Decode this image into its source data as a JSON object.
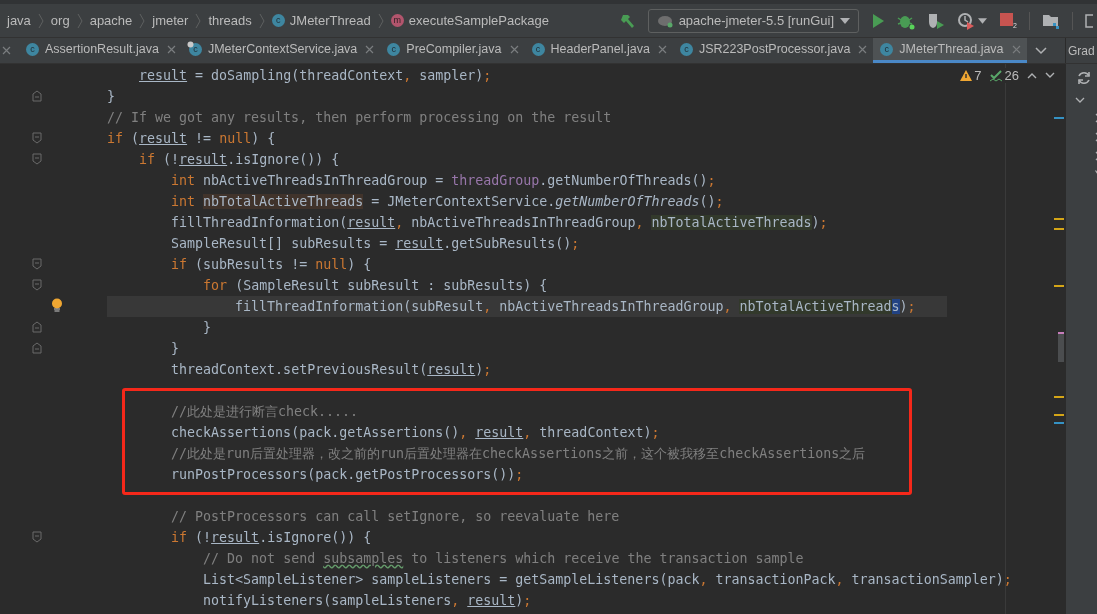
{
  "breadcrumbs": [
    {
      "label": "java"
    },
    {
      "label": "org"
    },
    {
      "label": "apache"
    },
    {
      "label": "jmeter"
    },
    {
      "label": "threads"
    },
    {
      "label": "JMeterThread",
      "kind": "class",
      "badge": "c"
    },
    {
      "label": "executeSamplePackage",
      "kind": "method",
      "badge": "m"
    }
  ],
  "run_config": {
    "label": "apache-jmeter-5.5 [runGui]"
  },
  "stop_badge": "2",
  "tabs": [
    {
      "label": "AssertionResult.java",
      "badge": "c",
      "locked": false,
      "selected": false
    },
    {
      "label": "JMeterContextService.java",
      "badge": "c",
      "locked": true,
      "selected": false
    },
    {
      "label": "PreCompiler.java",
      "badge": "c",
      "locked": false,
      "selected": false
    },
    {
      "label": "HeaderPanel.java",
      "badge": "c",
      "locked": false,
      "selected": false
    },
    {
      "label": "JSR223PostProcessor.java",
      "badge": "c",
      "locked": false,
      "selected": false
    },
    {
      "label": "JMeterThread.java",
      "badge": "c",
      "locked": false,
      "selected": true
    }
  ],
  "side_panel": {
    "title": "Grad"
  },
  "inspections": {
    "warnings": "7",
    "typos": "26"
  },
  "lines": [
    {
      "kind": "code",
      "current": false,
      "tokens": [
        {
          "kind": "underline",
          "text": "    result"
        },
        {
          "kind": "plain",
          "text": " = doSampling(threadContext"
        },
        {
          "kind": "punct",
          "text": ","
        },
        {
          "kind": "plain",
          "text": " sampler)"
        },
        {
          "kind": "punct",
          "text": ";"
        }
      ]
    },
    {
      "kind": "fold-end",
      "current": false,
      "tokens": [
        {
          "kind": "plain",
          "text": "}"
        }
      ]
    },
    {
      "kind": "code",
      "current": false,
      "tokens": [
        {
          "kind": "comment",
          "text": "// If we got any results, then perform processing on the result"
        }
      ]
    },
    {
      "kind": "fold-start",
      "current": false,
      "tokens": [
        {
          "kind": "keyword",
          "text": "if"
        },
        {
          "kind": "plain",
          "text": " ("
        },
        {
          "kind": "underline",
          "text": "result"
        },
        {
          "kind": "plain",
          "text": " != "
        },
        {
          "kind": "keyword",
          "text": "null"
        },
        {
          "kind": "plain",
          "text": ") {"
        }
      ]
    },
    {
      "kind": "fold-start",
      "current": false,
      "tokens": [
        {
          "kind": "keyword",
          "text": "    if"
        },
        {
          "kind": "plain",
          "text": " (!"
        },
        {
          "kind": "underline",
          "text": "result"
        },
        {
          "kind": "plain",
          "text": ".isIgnore()) {"
        }
      ]
    },
    {
      "kind": "code",
      "current": false,
      "tokens": [
        {
          "kind": "keyword",
          "text": "        int"
        },
        {
          "kind": "plain",
          "text": " nbActiveThreadsInThreadGroup = "
        },
        {
          "kind": "field",
          "text": "threadGroup"
        },
        {
          "kind": "plain",
          "text": ".getNumberOfThreads()"
        },
        {
          "kind": "punct",
          "text": ";"
        }
      ]
    },
    {
      "kind": "code",
      "current": false,
      "tokens": [
        {
          "kind": "keyword",
          "text": "        int "
        },
        {
          "kind": "write-usage",
          "text": "nbTotalActiveThreads"
        },
        {
          "kind": "plain",
          "text": " = JMeterContextService."
        },
        {
          "kind": "italic",
          "text": "getNumberOfThreads"
        },
        {
          "kind": "plain",
          "text": "()"
        },
        {
          "kind": "punct",
          "text": ";"
        }
      ]
    },
    {
      "kind": "code",
      "current": false,
      "tokens": [
        {
          "kind": "plain",
          "text": "        fillThreadInformation("
        },
        {
          "kind": "underline",
          "text": "result"
        },
        {
          "kind": "punct",
          "text": ","
        },
        {
          "kind": "plain",
          "text": " nbActiveThreadsInThreadGroup"
        },
        {
          "kind": "punct",
          "text": ", "
        },
        {
          "kind": "read-usage",
          "text": "nbTotalActiveThreads"
        },
        {
          "kind": "plain",
          "text": ")"
        },
        {
          "kind": "punct",
          "text": ";"
        }
      ]
    },
    {
      "kind": "code",
      "current": false,
      "tokens": [
        {
          "kind": "plain",
          "text": "        SampleResult[] subResults = "
        },
        {
          "kind": "underline",
          "text": "result"
        },
        {
          "kind": "plain",
          "text": ".getSubResults()"
        },
        {
          "kind": "punct",
          "text": ";"
        }
      ]
    },
    {
      "kind": "fold-start",
      "current": false,
      "tokens": [
        {
          "kind": "keyword",
          "text": "        if"
        },
        {
          "kind": "plain",
          "text": " (subResults != "
        },
        {
          "kind": "keyword",
          "text": "null"
        },
        {
          "kind": "plain",
          "text": ") {"
        }
      ]
    },
    {
      "kind": "fold-start",
      "current": false,
      "tokens": [
        {
          "kind": "keyword",
          "text": "            for"
        },
        {
          "kind": "plain",
          "text": " (SampleResult subResult : subResults) {"
        }
      ]
    },
    {
      "kind": "bulb",
      "current": true,
      "tokens": [
        {
          "kind": "plain",
          "text": "                fillThreadInformation(subResult"
        },
        {
          "kind": "punct",
          "text": ","
        },
        {
          "kind": "plain",
          "text": " nbActiveThreadsInThreadGroup"
        },
        {
          "kind": "punct",
          "text": ", "
        },
        {
          "kind": "read-usage",
          "text": "nbTotalActiveThread"
        },
        {
          "kind": "selection",
          "text": "s"
        },
        {
          "kind": "plain",
          "text": ")"
        },
        {
          "kind": "punct",
          "text": ";"
        }
      ]
    },
    {
      "kind": "fold-end",
      "current": false,
      "tokens": [
        {
          "kind": "plain",
          "text": "            }"
        }
      ]
    },
    {
      "kind": "fold-end",
      "current": false,
      "tokens": [
        {
          "kind": "plain",
          "text": "        }"
        }
      ]
    },
    {
      "kind": "code",
      "current": false,
      "tokens": [
        {
          "kind": "plain",
          "text": "        threadContext.setPreviousResult("
        },
        {
          "kind": "underline",
          "text": "result"
        },
        {
          "kind": "plain",
          "text": ")"
        },
        {
          "kind": "punct",
          "text": ";"
        }
      ]
    },
    {
      "kind": "blank"
    },
    {
      "kind": "code",
      "current": false,
      "tokens": [
        {
          "kind": "comment",
          "text": "        //此处是进行断言check....."
        }
      ]
    },
    {
      "kind": "code",
      "current": false,
      "tokens": [
        {
          "kind": "plain",
          "text": "        checkAssertions(pack.getAssertions()"
        },
        {
          "kind": "punct",
          "text": ", "
        },
        {
          "kind": "underline",
          "text": "result"
        },
        {
          "kind": "punct",
          "text": ","
        },
        {
          "kind": "plain",
          "text": " threadContext)"
        },
        {
          "kind": "punct",
          "text": ";"
        }
      ]
    },
    {
      "kind": "code",
      "current": false,
      "tokens": [
        {
          "kind": "comment",
          "text": "        //此处是run后置处理器，改之前的run后置处理器在checkAssertions之前，这个被我移至checkAssertions之后"
        }
      ]
    },
    {
      "kind": "code",
      "current": false,
      "tokens": [
        {
          "kind": "plain",
          "text": "        runPostProcessors(pack.getPostProcessors())"
        },
        {
          "kind": "punct",
          "text": ";"
        }
      ]
    },
    {
      "kind": "blank"
    },
    {
      "kind": "code",
      "current": false,
      "tokens": [
        {
          "kind": "comment",
          "text": "        // PostProcessors can call setIgnore, so reevaluate here"
        }
      ]
    },
    {
      "kind": "fold-start",
      "current": false,
      "tokens": [
        {
          "kind": "keyword",
          "text": "        if"
        },
        {
          "kind": "plain",
          "text": " (!"
        },
        {
          "kind": "underline",
          "text": "result"
        },
        {
          "kind": "plain",
          "text": ".isIgnore()) {"
        }
      ]
    },
    {
      "kind": "code",
      "current": false,
      "tokens": [
        {
          "kind": "comment",
          "text": "            // Do not send "
        },
        {
          "kind": "typo",
          "text": "subsamples"
        },
        {
          "kind": "comment",
          "text": " to listeners which receive the transaction sample"
        }
      ]
    },
    {
      "kind": "code",
      "current": false,
      "tokens": [
        {
          "kind": "plain",
          "text": "            List<SampleListener> sampleListeners = getSampleListeners(pack"
        },
        {
          "kind": "punct",
          "text": ","
        },
        {
          "kind": "plain",
          "text": " transactionPack"
        },
        {
          "kind": "punct",
          "text": ","
        },
        {
          "kind": "plain",
          "text": " transactionSampler)"
        },
        {
          "kind": "punct",
          "text": ";"
        }
      ]
    },
    {
      "kind": "code",
      "current": false,
      "tokens": [
        {
          "kind": "plain",
          "text": "            notifyListeners(sampleListeners"
        },
        {
          "kind": "punct",
          "text": ", "
        },
        {
          "kind": "underline",
          "text": "result"
        },
        {
          "kind": "plain",
          "text": ")"
        },
        {
          "kind": "punct",
          "text": ";"
        }
      ]
    }
  ]
}
